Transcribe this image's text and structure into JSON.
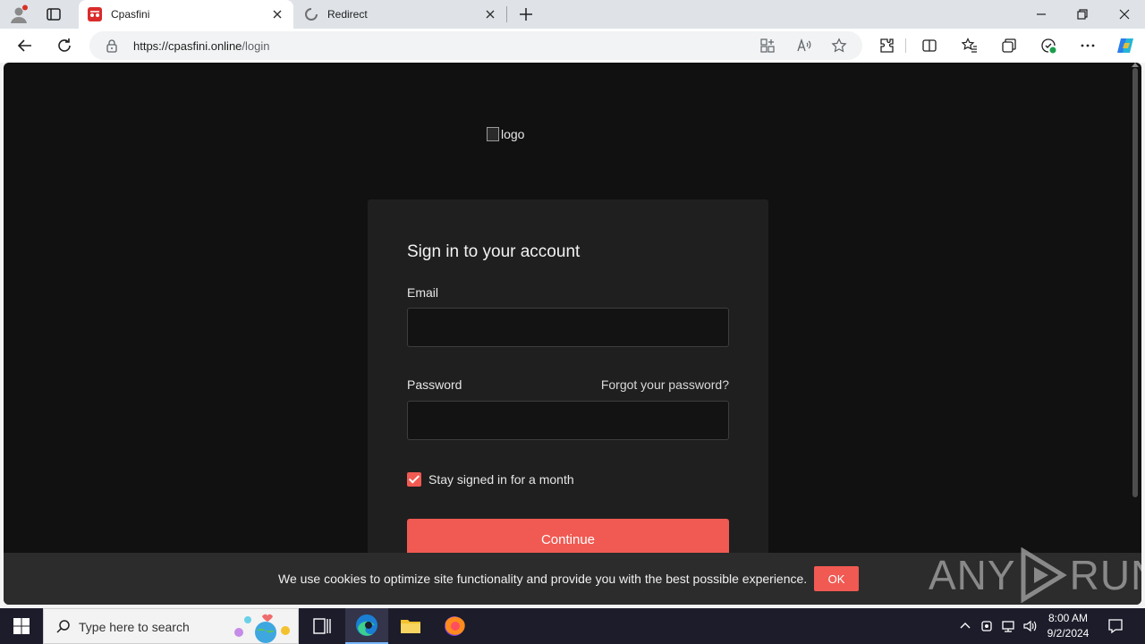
{
  "browser": {
    "tabs": [
      {
        "title": "Cpasfini",
        "active": true,
        "favicon": "cpasfini-favicon"
      },
      {
        "title": "Redirect",
        "active": false,
        "favicon": "loading-spinner-icon"
      }
    ],
    "url_host": "https://cpasfini.online",
    "url_path": "/login"
  },
  "page": {
    "logo_alt": "logo",
    "heading": "Sign in to your account",
    "email_label": "Email",
    "email_value": "",
    "password_label": "Password",
    "password_value": "",
    "forgot_link": "Forgot your password?",
    "stay_signed_in_label": "Stay signed in for a month",
    "stay_signed_in_checked": true,
    "continue_label": "Continue",
    "accent_color": "#f05a52"
  },
  "cookie": {
    "text": "We use cookies to optimize site functionality and provide you with the best possible experience.",
    "ok_label": "OK"
  },
  "watermark": {
    "left": "ANY",
    "right": "RUN"
  },
  "taskbar": {
    "search_placeholder": "Type here to search",
    "time": "8:00 AM",
    "date": "9/2/2024"
  }
}
